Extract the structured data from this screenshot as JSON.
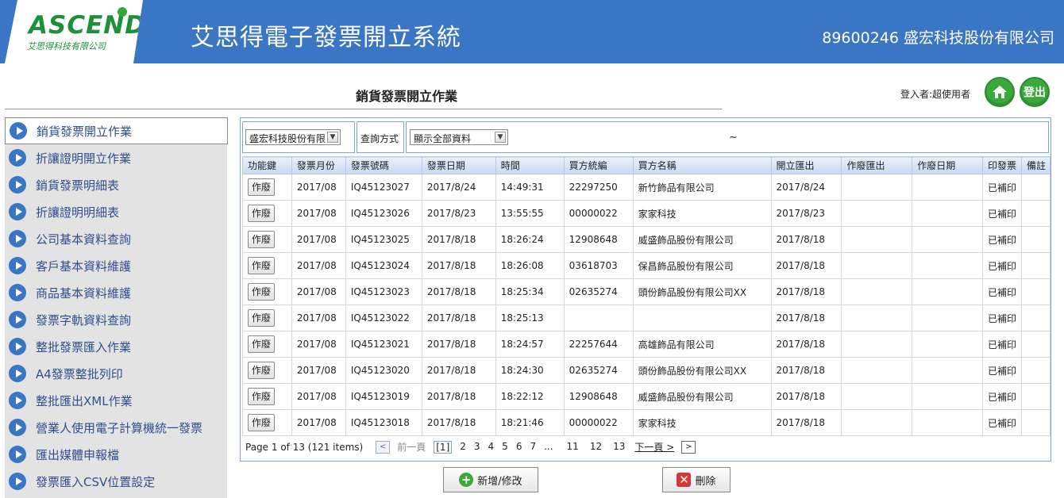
{
  "header": {
    "logo_text": "ASCEND",
    "logo_sub": "艾思得科技有限公司",
    "app_title": "艾思得電子發票開立系統",
    "company": "89600246 盛宏科技股份有限公司"
  },
  "subheader": {
    "page_title": "銷貨發票開立作業",
    "login_user": "登入者:超使用者",
    "logout_label": "登出"
  },
  "sidebar": {
    "items": [
      {
        "label": "銷貨發票開立作業"
      },
      {
        "label": "折讓證明開立作業"
      },
      {
        "label": "銷貨發票明細表"
      },
      {
        "label": "折讓證明明細表"
      },
      {
        "label": "公司基本資料查詢"
      },
      {
        "label": "客戶基本資料維護"
      },
      {
        "label": "商品基本資料維護"
      },
      {
        "label": "發票字軌資料查詢"
      },
      {
        "label": "整批發票匯入作業"
      },
      {
        "label": "A4發票整批列印"
      },
      {
        "label": "整批匯出XML作業"
      },
      {
        "label": "營業人使用電子計算機統一發票"
      },
      {
        "label": "匯出媒體申報檔"
      },
      {
        "label": "發票匯入CSV位置設定"
      }
    ]
  },
  "filter": {
    "company_select": "盛宏科技股份有限",
    "query_label": "查詢方式",
    "query_select": "顯示全部資料",
    "range_sep": "~"
  },
  "table": {
    "headers": [
      "功能鍵",
      "發票月份",
      "發票號碼",
      "發票日期",
      "時間",
      "買方統編",
      "買方名稱",
      "開立匯出",
      "作廢匯出",
      "作廢日期",
      "印發票",
      "備註"
    ],
    "void_label": "作廢",
    "rows": [
      [
        "2017/08",
        "IQ45123027",
        "2017/8/24",
        "14:49:31",
        "22297250",
        "新竹飾品有限公司",
        "2017/8/24",
        "",
        "",
        "已補印",
        ""
      ],
      [
        "2017/08",
        "IQ45123026",
        "2017/8/23",
        "13:55:55",
        "00000022",
        "家家科技",
        "2017/8/23",
        "",
        "",
        "已補印",
        ""
      ],
      [
        "2017/08",
        "IQ45123025",
        "2017/8/18",
        "18:26:24",
        "12908648",
        "威盛飾品股份有限公司",
        "2017/8/18",
        "",
        "",
        "已補印",
        ""
      ],
      [
        "2017/08",
        "IQ45123024",
        "2017/8/18",
        "18:26:08",
        "03618703",
        "保昌飾品股份有限公司",
        "2017/8/18",
        "",
        "",
        "已補印",
        ""
      ],
      [
        "2017/08",
        "IQ45123023",
        "2017/8/18",
        "18:25:34",
        "02635274",
        "頭份飾品股份有限公司XX",
        "2017/8/18",
        "",
        "",
        "已補印",
        ""
      ],
      [
        "2017/08",
        "IQ45123022",
        "2017/8/18",
        "18:25:13",
        "",
        "",
        "2017/8/18",
        "",
        "",
        "已補印",
        ""
      ],
      [
        "2017/08",
        "IQ45123021",
        "2017/8/18",
        "18:24:57",
        "22257644",
        "高雄飾品有限公司",
        "2017/8/18",
        "",
        "",
        "已補印",
        ""
      ],
      [
        "2017/08",
        "IQ45123020",
        "2017/8/18",
        "18:24:30",
        "02635274",
        "頭份飾品股份有限公司XX",
        "2017/8/18",
        "",
        "",
        "已補印",
        ""
      ],
      [
        "2017/08",
        "IQ45123019",
        "2017/8/18",
        "18:22:12",
        "12908648",
        "威盛飾品股份有限公司",
        "2017/8/18",
        "",
        "",
        "已補印",
        ""
      ],
      [
        "2017/08",
        "IQ45123018",
        "2017/8/18",
        "18:21:46",
        "00000022",
        "家家科技",
        "2017/8/18",
        "",
        "",
        "已補印",
        ""
      ]
    ]
  },
  "pager": {
    "summary": "Page 1 of 13 (121 items)",
    "prev_label": "前一頁",
    "pages": [
      "[1]",
      "2",
      "3",
      "4",
      "5",
      "6",
      "7",
      "...",
      "11",
      "12",
      "13"
    ],
    "next_label": "下一頁 >"
  },
  "actions": {
    "add_label": "新增/修改",
    "delete_label": "刪除"
  }
}
